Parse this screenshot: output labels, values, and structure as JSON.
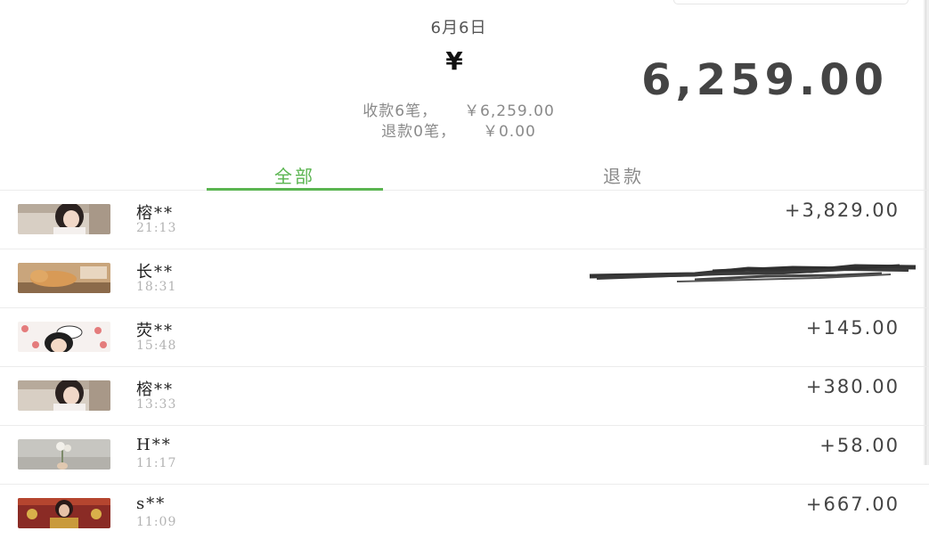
{
  "header": {
    "date": "6月6日",
    "total_currency": "¥",
    "total_amount": "6,259.00",
    "received_label": "收款6笔，",
    "received_amount": "￥6,259.00",
    "refund_label": "退款0笔，",
    "refund_amount": "￥0.00"
  },
  "tabs": [
    {
      "label": "全部",
      "active": true
    },
    {
      "label": "退款",
      "active": false
    }
  ],
  "colors": {
    "accent": "#5bb551",
    "amount": "#444444",
    "muted": "#8a8a8a"
  },
  "transactions": [
    {
      "name": "榕**",
      "time": "21:13",
      "amount": "+3,829.00",
      "avatar": "girl-photo-avatar"
    },
    {
      "name": "长**",
      "time": "18:31",
      "amount": "",
      "redacted": true,
      "avatar": "cat-photo-avatar"
    },
    {
      "name": "荧**",
      "time": "15:48",
      "amount": "+145.00",
      "avatar": "cartoon-avatar"
    },
    {
      "name": "榕**",
      "time": "13:33",
      "amount": "+380.00",
      "avatar": "girl-photo-avatar"
    },
    {
      "name": "H**",
      "time": "11:17",
      "amount": "+58.00",
      "avatar": "flower-photo-avatar"
    },
    {
      "name": "s**",
      "time": "11:09",
      "amount": "+667.00",
      "avatar": "costume-photo-avatar"
    }
  ]
}
